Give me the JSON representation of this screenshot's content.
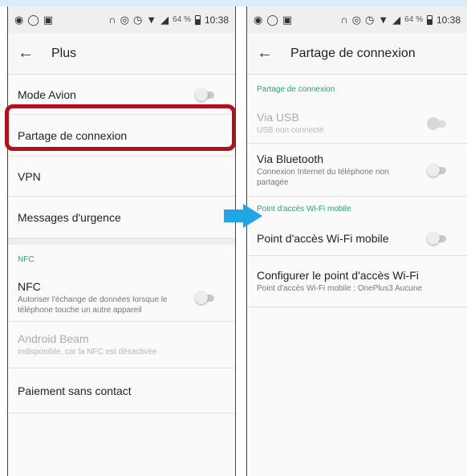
{
  "status_bar": {
    "battery_pct": "64 %",
    "time": "10:38"
  },
  "left": {
    "title": "Plus",
    "rows": {
      "airplane": "Mode Avion",
      "tethering": "Partage de connexion",
      "vpn": "VPN",
      "emergency": "Messages d'urgence"
    },
    "nfc_section": "NFC",
    "nfc": {
      "title": "NFC",
      "subtitle": "Autoriser l'échange de données lorsque le téléphone touche un autre appareil"
    },
    "beam": {
      "title": "Android Beam",
      "subtitle": "Indisponible, car la NFC est désactivée"
    },
    "contactless": "Paiement sans contact"
  },
  "right": {
    "title": "Partage de connexion",
    "section1": "Partage de connexion",
    "usb": {
      "title": "Via USB",
      "subtitle": "USB non connecté"
    },
    "bluetooth": {
      "title": "Via Bluetooth",
      "subtitle": "Connexion Internet du téléphone non partagée"
    },
    "section2": "Point d'accès Wi-Fi mobile",
    "hotspot": "Point d'accès Wi-Fi mobile",
    "configure": {
      "title": "Configurer le point d'accès Wi-Fi",
      "subtitle": "Point d'accès Wi-Fi mobile : OnePlus3 Aucune"
    }
  },
  "colors": {
    "highlight": "#b0121c",
    "arrow": "#1ea6e6",
    "section": "#2e9e74"
  },
  "icons": [
    "spotify-icon",
    "whatsapp-icon",
    "gallery-icon",
    "headphones-icon",
    "eye-icon",
    "alarm-icon",
    "wifi-icon",
    "signal-icon",
    "battery-icon",
    "back-arrow-icon"
  ]
}
